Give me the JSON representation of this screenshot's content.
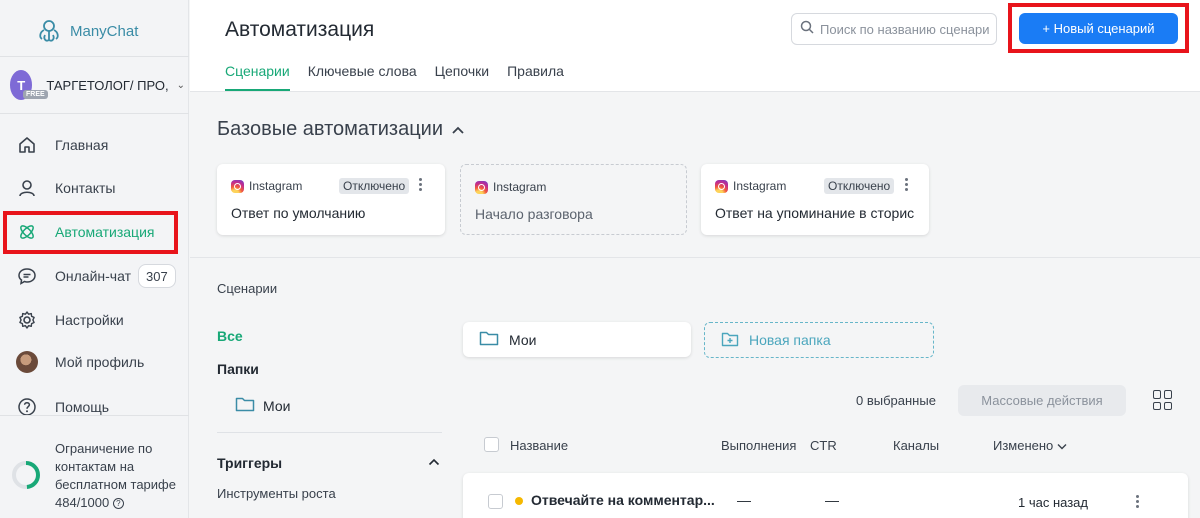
{
  "app": {
    "name": "ManyChat"
  },
  "account": {
    "initial": "T",
    "plan_badge": "FREE",
    "name": "ТАРГЕТОЛОГ/ ПРО,"
  },
  "sidebar": {
    "items": [
      {
        "label": "Главная",
        "icon": "home-icon"
      },
      {
        "label": "Контакты",
        "icon": "user-icon"
      },
      {
        "label": "Автоматизация",
        "icon": "automation-icon",
        "active": true
      },
      {
        "label": "Онлайн-чат",
        "icon": "chat-icon",
        "badge": "307"
      },
      {
        "label": "Настройки",
        "icon": "gear-icon"
      },
      {
        "label": "Мой профиль",
        "icon": "profile-avatar"
      },
      {
        "label": "Помощь",
        "icon": "help-icon"
      }
    ],
    "limit": {
      "text": "Ограничение по контактам на бесплатном тарифе",
      "usage": "484/1000",
      "fraction": 0.484
    }
  },
  "header": {
    "title": "Автоматизация",
    "tabs": [
      "Сценарии",
      "Ключевые слова",
      "Цепочки",
      "Правила"
    ],
    "search_placeholder": "Поиск по названию сценари",
    "new_button": "+ Новый сценарий"
  },
  "basic": {
    "title": "Базовые автоматизации",
    "cards": [
      {
        "channel": "Instagram",
        "status": "Отключено",
        "title": "Ответ по умолчанию"
      },
      {
        "channel": "Instagram",
        "status": "",
        "title": "Начало разговора"
      },
      {
        "channel": "Instagram",
        "status": "Отключено",
        "title": "Ответ на упоминание в сторис"
      }
    ]
  },
  "scenarios": {
    "label": "Сценарии",
    "filter_all": "Все",
    "folders_heading": "Папки",
    "folder_moi": "Мои",
    "triggers_heading": "Триггеры",
    "growth_tools": "Инструменты роста",
    "folder_card": "Мои",
    "new_folder": "Новая папка",
    "selected": "0 выбранные",
    "mass_actions": "Массовые действия",
    "columns": {
      "name": "Название",
      "runs": "Выполнения",
      "ctr": "CTR",
      "channels": "Каналы",
      "modified": "Изменено"
    },
    "rows": [
      {
        "name": "Отвечайте на комментар...",
        "runs": "—",
        "ctr": "—",
        "modified": "1 час назад"
      }
    ]
  },
  "colors": {
    "accent": "#18a877",
    "primary_button": "#1a7cf5",
    "highlight": "#e8141b",
    "status_dot": "#f5b800"
  }
}
